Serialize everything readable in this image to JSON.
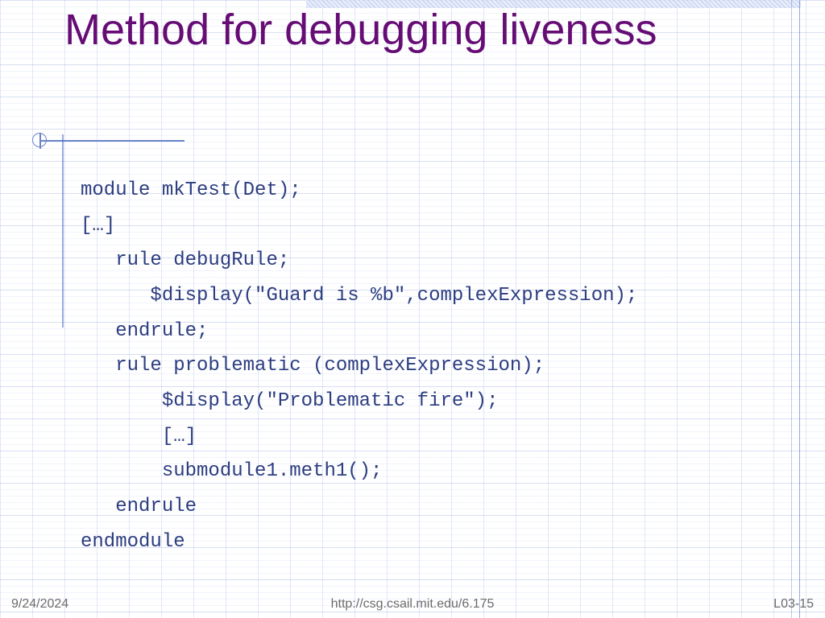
{
  "title": "Method for debugging liveness",
  "code": "module mkTest(Det);\n[…]\n   rule debugRule;\n      $display(\"Guard is %b\",complexExpression);\n   endrule;\n   rule problematic (complexExpression);\n       $display(\"Problematic fire\");\n       […]\n       submodule1.meth1();\n   endrule\nendmodule",
  "footer": {
    "date": "9/24/2024",
    "url": "http://csg.csail.mit.edu/6.175",
    "slide": "L03-15"
  }
}
